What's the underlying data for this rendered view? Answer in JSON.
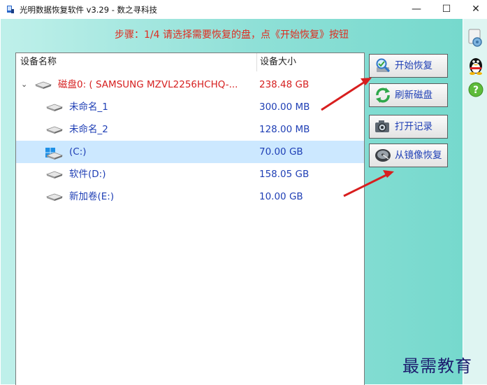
{
  "window": {
    "title": "光明数据恢复软件 v3.29 - 数之寻科技",
    "minimize_glyph": "—",
    "maximize_glyph": "☐",
    "close_glyph": "✕"
  },
  "step_text": "步骤：1/4 请选择需要恢复的盘，点《开始恢复》按钮",
  "tree": {
    "headers": {
      "name": "设备名称",
      "size": "设备大小"
    },
    "rows": [
      {
        "name": "磁盘0: ( SAMSUNG MZVL2256HCHQ-...",
        "size": "238.48 GB",
        "icon": "hard-disk-icon",
        "expander": "⌄"
      },
      {
        "name": "未命名_1",
        "size": "300.00 MB",
        "icon": "disk-partition-icon"
      },
      {
        "name": "未命名_2",
        "size": "128.00 MB",
        "icon": "disk-partition-icon"
      },
      {
        "name": "(C:)",
        "size": "70.00 GB",
        "icon": "windows-drive-icon",
        "selected": true
      },
      {
        "name": "软件(D:)",
        "size": "158.05 GB",
        "icon": "disk-partition-icon"
      },
      {
        "name": "新加卷(E:)",
        "size": "10.00 GB",
        "icon": "disk-partition-icon"
      }
    ]
  },
  "buttons": {
    "start": {
      "label": "开始恢复",
      "icon": "magnifier-icon"
    },
    "refresh": {
      "label": "刷新磁盘",
      "icon": "refresh-icon"
    },
    "open_log": {
      "label": "打开记录",
      "icon": "camera-icon"
    },
    "from_image": {
      "label": "从镜像恢复",
      "icon": "disk-image-icon"
    }
  },
  "right_toolbar": {
    "icons": [
      "settings-gears-icon",
      "qq-penguin-icon",
      "help-icon"
    ]
  },
  "watermark": "最需教育",
  "colors": {
    "accent_text": "#1f3fb5",
    "highlight_red": "#d62020",
    "selection": "#cce8ff",
    "arrow": "#d81e1e"
  }
}
